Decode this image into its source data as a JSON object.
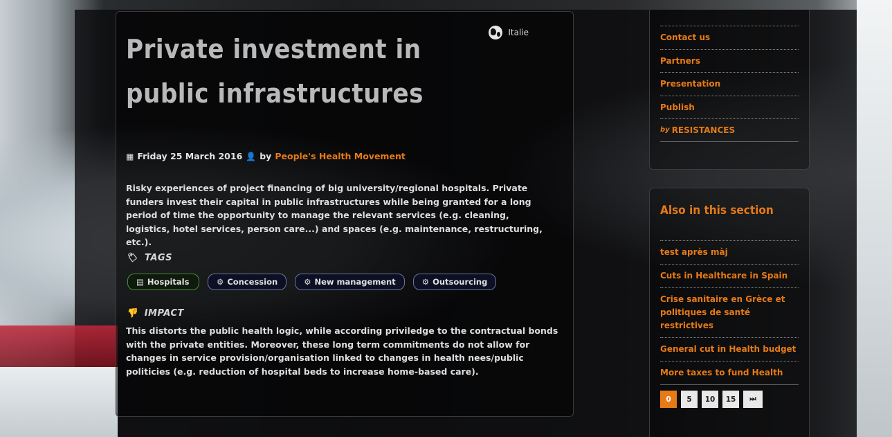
{
  "article": {
    "title": "Private investment in public infrastructures",
    "country": "Italie",
    "date": "Friday 25 March 2016",
    "by_label": "by",
    "author": "People's Health Movement",
    "lead": "Risky experiences of project financing of big university/regional hospitals. Private funders invest their capital in public infrastructures while being granted for a long period of time the opportunity to manage the relevant services (e.g. cleaning, logistics, hotel services, person care...) and spaces (e.g. maintenance, restructuring, etc.).",
    "tags_heading": "TAGS",
    "tags": [
      {
        "label": "Hospitals"
      },
      {
        "label": "Concession"
      },
      {
        "label": "New management"
      },
      {
        "label": "Outsourcing"
      }
    ],
    "impact_heading": "IMPACT",
    "impact": "This distorts the public health logic, while according priviledge to the contractual bonds with the private entities. Moreover, these long term commitments do not allow for changes in service provision/organisation linked to changes in health nees/public politicies (e.g. reduction of hospital beds to increase home-based care)."
  },
  "sidebar": {
    "links": [
      {
        "label": "Contact us"
      },
      {
        "label": "Partners"
      },
      {
        "label": "Presentation"
      },
      {
        "label": "Publish"
      },
      {
        "label": "RESISTANCES",
        "prefix": "by"
      }
    ],
    "section_title": "Also in this section",
    "also_items": [
      {
        "label": "test après màj"
      },
      {
        "label": "Cuts in Healthcare in Spain"
      },
      {
        "label": "Crise sanitaire en Grèce et politiques de santé restrictives"
      },
      {
        "label": "General cut in Health budget"
      },
      {
        "label": "More taxes to fund Health"
      }
    ],
    "pager": [
      "0",
      "5",
      "10",
      "15",
      "⏭"
    ]
  },
  "colors": {
    "accent": "#e67a16",
    "tag_border": "#6c7799",
    "tag_green_border": "#4f8a3a"
  }
}
